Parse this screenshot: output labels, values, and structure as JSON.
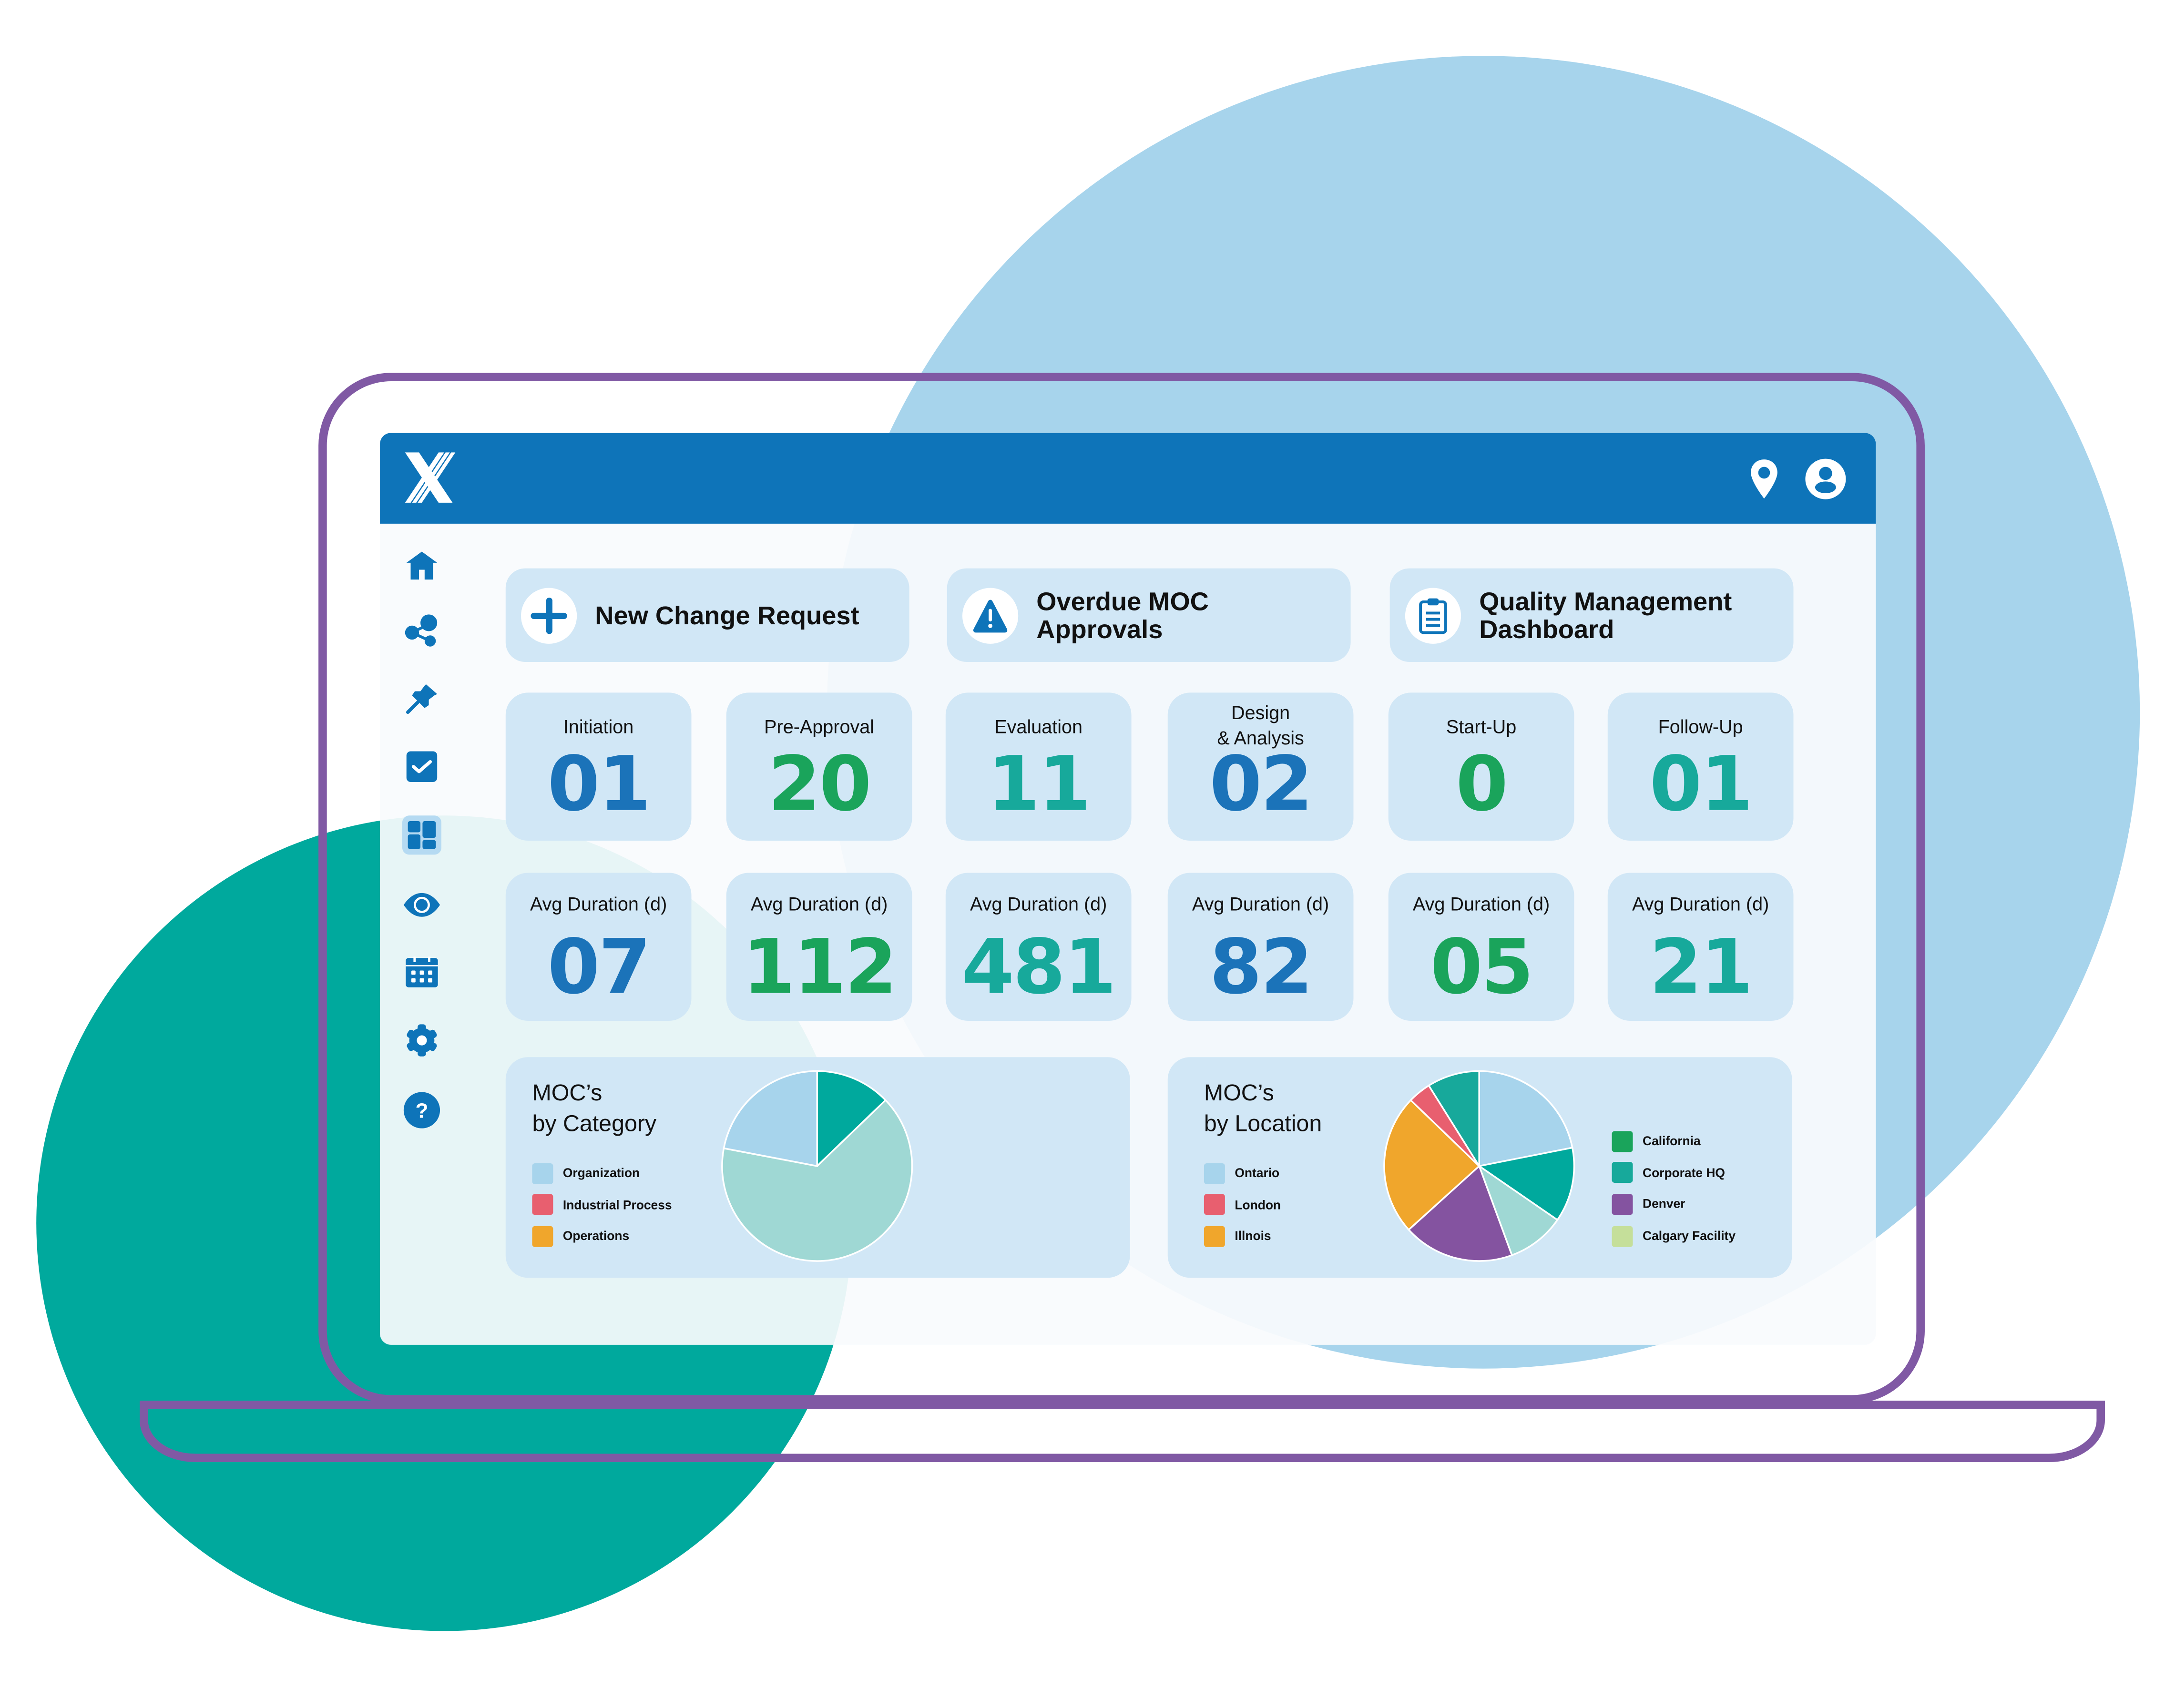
{
  "app": {
    "logo": "x-logo",
    "header_icons": [
      {
        "name": "location-pin-icon"
      },
      {
        "name": "user-account-icon"
      }
    ],
    "colors": {
      "header": "#0E74B9",
      "card_bg": "#D1E7F6",
      "blue": "#1B73B9",
      "green": "#1AA45B",
      "teal": "#17A99B",
      "frame": "#8059A4"
    }
  },
  "sidebar": {
    "items": [
      {
        "name": "home",
        "icon": "home-icon"
      },
      {
        "name": "workflow",
        "icon": "share-nodes-icon"
      },
      {
        "name": "pinned",
        "icon": "pushpin-icon"
      },
      {
        "name": "tasks",
        "icon": "checkbox-icon"
      },
      {
        "name": "dashboard",
        "icon": "dashboard-grid-icon",
        "active": true
      },
      {
        "name": "view",
        "icon": "eye-icon"
      },
      {
        "name": "calendar",
        "icon": "calendar-icon"
      },
      {
        "name": "settings",
        "icon": "gear-icon"
      },
      {
        "name": "help",
        "icon": "help-circle-icon"
      }
    ]
  },
  "actions": [
    {
      "label": "New Change Request",
      "icon": "plus-icon"
    },
    {
      "label": "Overdue MOC\nApprovals",
      "icon": "warning-triangle-icon"
    },
    {
      "label": "Quality Management\nDashboard",
      "icon": "clipboard-icon"
    }
  ],
  "stages": [
    {
      "title": "Initiation",
      "count": "01",
      "avg_label": "Avg Duration (d)",
      "avg": "07",
      "color": "#1B73B9"
    },
    {
      "title": "Pre-Approval",
      "count": "20",
      "avg_label": "Avg Duration (d)",
      "avg": "112",
      "color": "#1AA45B"
    },
    {
      "title": "Evaluation",
      "count": "11",
      "avg_label": "Avg Duration (d)",
      "avg": "481",
      "color": "#17A99B"
    },
    {
      "title": "Design\n& Analysis",
      "count": "02",
      "avg_label": "Avg Duration (d)",
      "avg": "82",
      "color": "#1B73B9"
    },
    {
      "title": "Start-Up",
      "count": "0",
      "avg_label": "Avg Duration (d)",
      "avg": "05",
      "color": "#1AA45B"
    },
    {
      "title": "Follow-Up",
      "count": "01",
      "avg_label": "Avg Duration (d)",
      "avg": "21",
      "color": "#17A99B"
    }
  ],
  "chart_data": [
    {
      "type": "pie",
      "title": "MOC’s\nby Category",
      "legend": [
        {
          "label": "Organization",
          "color": "#A7D4EC"
        },
        {
          "label": "Industrial Process",
          "color": "#E85F6F"
        },
        {
          "label": "Operations",
          "color": "#F0A62C"
        }
      ],
      "legend_position": "left",
      "slices": [
        {
          "value": 12.8,
          "color": "#00A99D"
        },
        {
          "value": 65.2,
          "color": "#9FD8D4"
        },
        {
          "value": 22.0,
          "color": "#A7D4EC"
        }
      ],
      "units": "percent",
      "start": "top",
      "direction": "clockwise"
    },
    {
      "type": "pie",
      "title": "MOC’s\nby Location",
      "legend": [
        {
          "label": "Ontario",
          "color": "#A7D4EC"
        },
        {
          "label": "London",
          "color": "#E85F6F"
        },
        {
          "label": "Illnois",
          "color": "#F0A62C"
        }
      ],
      "legend2": [
        {
          "label": "California",
          "color": "#1AA45B"
        },
        {
          "label": "Corporate HQ",
          "color": "#17A99B"
        },
        {
          "label": "Denver",
          "color": "#8453A0"
        },
        {
          "label": "Calgary Facility",
          "color": "#C5DF9A"
        }
      ],
      "legend_position": "left-and-right",
      "slices": [
        {
          "value": 21.9,
          "color": "#A7D4EC"
        },
        {
          "value": 12.7,
          "color": "#00A99D"
        },
        {
          "value": 9.8,
          "color": "#9FD8D4"
        },
        {
          "value": 18.9,
          "color": "#8453A0"
        },
        {
          "value": 23.9,
          "color": "#F0A62C"
        },
        {
          "value": 3.9,
          "color": "#E85F6F"
        },
        {
          "value": 8.9,
          "color": "#17A99B"
        }
      ],
      "units": "percent",
      "start": "top",
      "direction": "clockwise"
    }
  ]
}
